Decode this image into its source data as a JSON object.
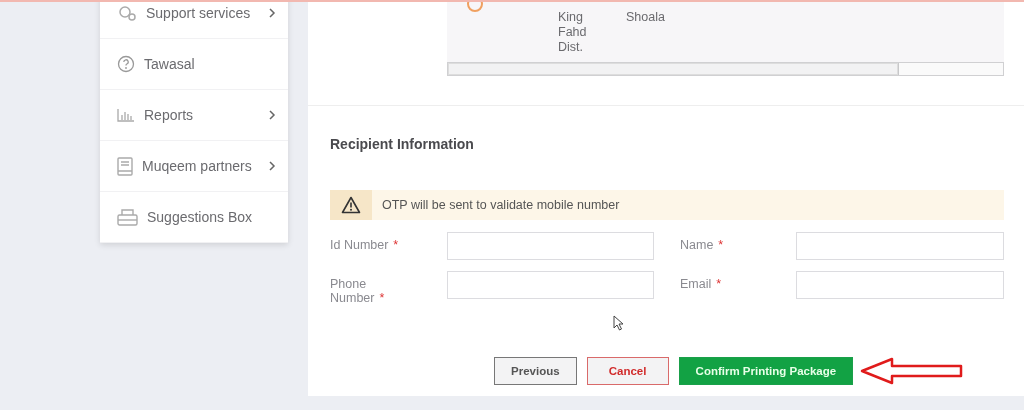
{
  "sidebar": {
    "items": [
      {
        "label": "Support services",
        "has_submenu": true
      },
      {
        "label": "Tawasal",
        "has_submenu": false
      },
      {
        "label": "Reports",
        "has_submenu": true
      },
      {
        "label": "Muqeem partners",
        "has_submenu": true
      },
      {
        "label": "Suggestions Box",
        "has_submenu": false
      }
    ]
  },
  "address_table": {
    "rows": [
      {
        "column_2": [
          "King",
          "Fahd",
          "Dist."
        ],
        "column_3": [
          "Shoala"
        ]
      }
    ]
  },
  "recipient": {
    "title": "Recipient Information",
    "notice": "OTP will be sent to validate mobile number",
    "fields": [
      {
        "label": "Id Number",
        "mark": "*"
      },
      {
        "label": "Name",
        "mark": "*"
      },
      {
        "label": "Phone Number",
        "mark": "*"
      },
      {
        "label": "Email",
        "mark": "*"
      }
    ]
  },
  "buttons": [
    {
      "label": "Previous",
      "kind": "default"
    },
    {
      "label": "Cancel",
      "kind": "danger"
    },
    {
      "label": "Confirm Printing Package",
      "kind": "primary"
    }
  ]
}
